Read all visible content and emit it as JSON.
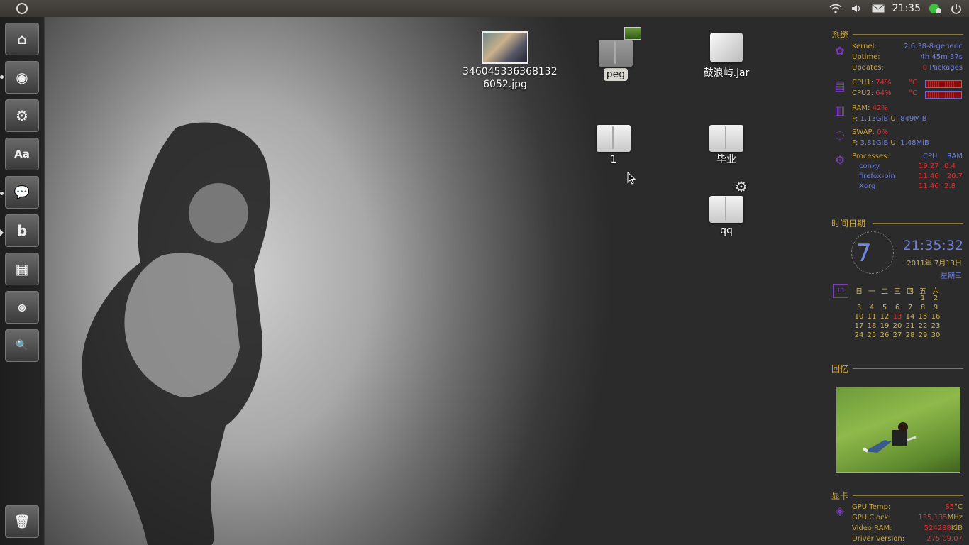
{
  "top_panel": {
    "clock": "21:35",
    "icons": [
      "ubuntu-circle-icon",
      "wifi-icon",
      "volume-icon",
      "mail-icon",
      "chat-icon",
      "power-icon"
    ]
  },
  "launcher": {
    "items": [
      {
        "name": "home-folder",
        "glyph": "⌂"
      },
      {
        "name": "firefox",
        "glyph": "◉"
      },
      {
        "name": "ubuntu-software",
        "glyph": "⚙"
      },
      {
        "name": "font-viewer",
        "glyph": "Aa"
      },
      {
        "name": "empathy-chat",
        "glyph": "💬"
      },
      {
        "name": "banshee",
        "glyph": "b"
      },
      {
        "name": "workspaces",
        "glyph": "▦"
      },
      {
        "name": "magnifier",
        "glyph": "⊕"
      },
      {
        "name": "search-files",
        "glyph": "🔍"
      },
      {
        "name": "trash",
        "glyph": "🗑"
      }
    ]
  },
  "desktop": {
    "icons": [
      {
        "label": "346045336368132\n6052.jpg",
        "line1": "346045336368132",
        "line2": "6052.jpg"
      },
      {
        "label": "peg"
      },
      {
        "label": "鼓浪屿.jar"
      },
      {
        "label": "1"
      },
      {
        "label": "毕业"
      },
      {
        "label": "qq"
      }
    ]
  },
  "conky": {
    "system": {
      "header": "系统",
      "kernel_label": "Kernel:",
      "kernel_value": "2.6.38-8-generic",
      "uptime_label": "Uptime:",
      "uptime_value": "4h 45m 37s",
      "updates_label": "Updates:",
      "updates_count": "0",
      "updates_unit": "Packages",
      "cpu1_label": "CPU1:",
      "cpu1_value": "74%",
      "cpu1_temp": "°C",
      "cpu2_label": "CPU2:",
      "cpu2_value": "64%",
      "cpu2_temp": "°C",
      "ram_label": "RAM:",
      "ram_value": "42%",
      "ram_free_label": "F:",
      "ram_free": "1.13GiB",
      "ram_used_label": "U:",
      "ram_used": "849MiB",
      "swap_label": "SWAP:",
      "swap_value": "0%",
      "swap_free_label": "F:",
      "swap_free": "3.81GiB",
      "swap_used_label": "U:",
      "swap_used": "1.48MiB",
      "processes_label": "Processes:",
      "proc_cpu_header": "CPU",
      "proc_ram_header": "RAM",
      "processes": [
        {
          "name": "conky",
          "cpu": "19.27",
          "ram": "0.4"
        },
        {
          "name": "firefox-bin",
          "cpu": "11.46",
          "ram": "20.7"
        },
        {
          "name": "Xorg",
          "cpu": "11.46",
          "ram": "2.8"
        }
      ],
      "ram_fraction": 0.42,
      "swap_fraction": 0.0
    },
    "datetime": {
      "header": "时间日期",
      "clock_digit": "7",
      "time": "21:35:32",
      "date": "2011年  7月13日",
      "weekday": "星期三",
      "calendar_icon_text": "13",
      "weekdays": [
        "日",
        "一",
        "二",
        "三",
        "四",
        "五",
        "六"
      ],
      "weeks": [
        [
          "",
          "",
          "",
          "",
          "",
          "1",
          "2"
        ],
        [
          "3",
          "4",
          "5",
          "6",
          "7",
          "8",
          "9"
        ],
        [
          "10",
          "11",
          "12",
          "13",
          "14",
          "15",
          "16"
        ],
        [
          "17",
          "18",
          "19",
          "20",
          "21",
          "22",
          "23"
        ],
        [
          "24",
          "25",
          "26",
          "27",
          "28",
          "29",
          "30"
        ]
      ],
      "today": "13"
    },
    "memory": {
      "header": "回忆"
    },
    "gpu": {
      "header": "显卡",
      "temp_label": "GPU Temp:",
      "temp_value": "85",
      "temp_unit": "°C",
      "clock_label": "GPU Clock:",
      "clock_value": "135,135",
      "clock_unit": "MHz",
      "vram_label": "Video RAM:",
      "vram_value": "524288",
      "vram_unit": "KiB",
      "driver_label": "Driver Version:",
      "driver_value": "275.09.07"
    }
  },
  "colors": {
    "accent_gold": "#c9a441",
    "accent_blue": "#6c7fe0",
    "accent_red": "#e03030",
    "icon_purple": "#7a3ac0"
  }
}
